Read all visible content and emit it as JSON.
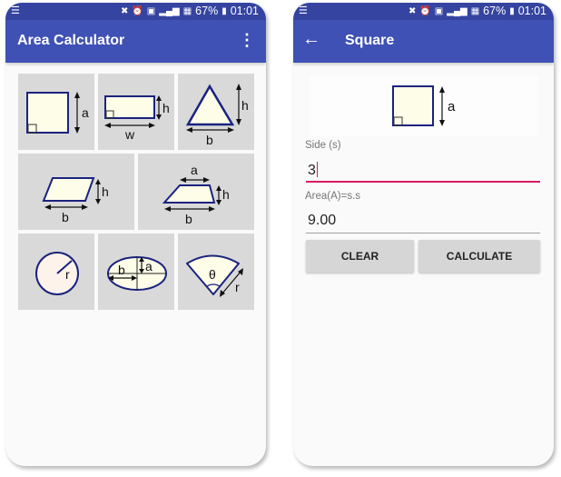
{
  "status_bar": {
    "notification_icon": "notification-list-icon",
    "icons": [
      "mute-icon",
      "alarm-icon",
      "sim-icon",
      "signal-icon",
      "signal-icon"
    ],
    "battery": "67%",
    "time": "01:01"
  },
  "left_screen": {
    "app_title": "Area Calculator",
    "menu_icon": "overflow-menu-icon",
    "shapes": [
      {
        "name": "square",
        "labels": [
          "a"
        ]
      },
      {
        "name": "rectangle",
        "labels": [
          "h",
          "w"
        ]
      },
      {
        "name": "triangle",
        "labels": [
          "h",
          "b"
        ]
      },
      {
        "name": "parallelogram",
        "labels": [
          "h",
          "b"
        ]
      },
      {
        "name": "trapezoid",
        "labels": [
          "a",
          "h",
          "b"
        ]
      },
      {
        "name": "circle",
        "labels": [
          "r"
        ]
      },
      {
        "name": "ellipse",
        "labels": [
          "b",
          "a"
        ]
      },
      {
        "name": "sector",
        "labels": [
          "θ",
          "r"
        ]
      }
    ]
  },
  "right_screen": {
    "title": "Square",
    "back_icon": "arrow-left-icon",
    "figure_label": "a",
    "side_field": {
      "label": "Side (s)",
      "value": "3"
    },
    "area_field": {
      "label": "Area(A)=s.s",
      "value": "9.00"
    },
    "buttons": {
      "clear": "CLEAR",
      "calculate": "CALCULATE"
    }
  },
  "colors": {
    "status_bar": "#3544a0",
    "app_bar": "#3f51b5",
    "accent": "#d81b60",
    "shape_stroke": "#1a237e",
    "shape_fill": "#fdfde8",
    "tile_bg": "#d9d9d9"
  }
}
